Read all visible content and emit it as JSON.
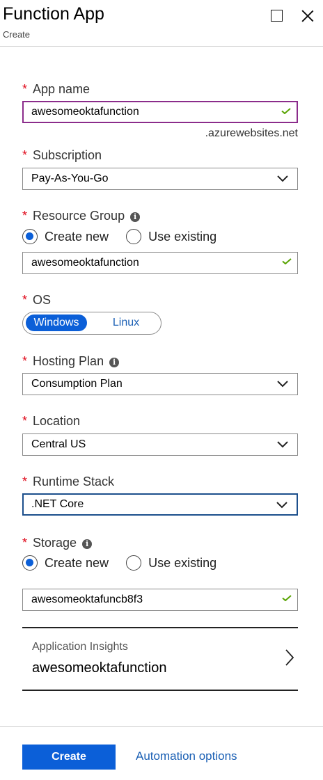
{
  "header": {
    "title": "Function App",
    "subtitle": "Create"
  },
  "app_name": {
    "label": "App name",
    "value": "awesomeoktafunction",
    "suffix": ".azurewebsites.net"
  },
  "subscription": {
    "label": "Subscription",
    "value": "Pay-As-You-Go"
  },
  "resource_group": {
    "label": "Resource Group",
    "options": [
      "Create new",
      "Use existing"
    ],
    "selected": "Create new",
    "value": "awesomeoktafunction"
  },
  "os": {
    "label": "OS",
    "options": [
      "Windows",
      "Linux"
    ],
    "selected": "Windows"
  },
  "hosting_plan": {
    "label": "Hosting Plan",
    "value": "Consumption Plan"
  },
  "location": {
    "label": "Location",
    "value": "Central US"
  },
  "runtime_stack": {
    "label": "Runtime Stack",
    "value": ".NET Core"
  },
  "storage": {
    "label": "Storage",
    "options": [
      "Create new",
      "Use existing"
    ],
    "selected": "Create new",
    "value": "awesomeoktafuncb8f3"
  },
  "app_insights": {
    "label": "Application Insights",
    "value": "awesomeoktafunction"
  },
  "footer": {
    "create_label": "Create",
    "automation_label": "Automation options"
  },
  "colors": {
    "accent": "#0b5fd8",
    "required": "#e00b1c",
    "valid": "#57a300",
    "focus_purple": "#8b2c8b"
  },
  "icons": {
    "info": "info-icon",
    "check": "checkmark-icon",
    "dropdown": "chevron-down-icon",
    "next": "chevron-right-icon"
  }
}
